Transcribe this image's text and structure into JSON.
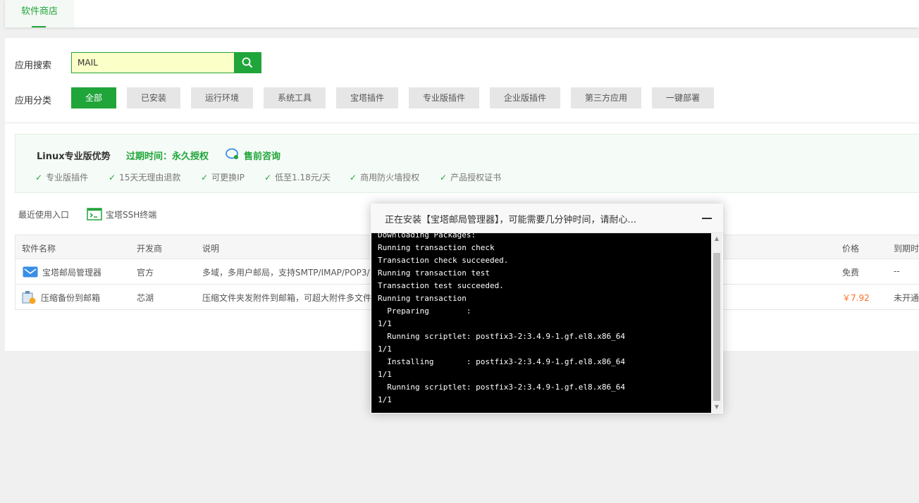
{
  "top_tab": {
    "label": "软件商店"
  },
  "search": {
    "label": "应用搜索",
    "value": "MAIL"
  },
  "categories": {
    "label": "应用分类",
    "items": [
      "全部",
      "已安装",
      "运行环境",
      "系统工具",
      "宝塔插件",
      "专业版插件",
      "企业版插件",
      "第三方应用",
      "一键部署"
    ],
    "active": "全部"
  },
  "promo": {
    "title": "Linux专业版优势",
    "expire": "过期时间：永久授权",
    "consult": "售前咨询",
    "features": [
      "专业版插件",
      "15天无理由退款",
      "可更换IP",
      "低至1.18元/天",
      "商用防火墙授权",
      "产品授权证书"
    ]
  },
  "recent": {
    "label": "最近使用入口",
    "ssh_label": "宝塔SSH终端"
  },
  "table": {
    "headers": {
      "name": "软件名称",
      "vendor": "开发商",
      "desc": "说明",
      "price": "价格",
      "expire": "到期时"
    },
    "rows": [
      {
        "name": "宝塔邮局管理器",
        "vendor": "官方",
        "desc": "多域，多用户邮局，支持SMTP/IMAP/POP3/",
        "price": "免费",
        "expire": "--"
      },
      {
        "name": "压缩备份到邮箱",
        "vendor": "芯湖",
        "desc": "压缩文件夹发附件到邮箱，可超大附件多文件",
        "price": "￥7.92",
        "expire": "未开通"
      }
    ]
  },
  "dialog": {
    "title": "正在安装【宝塔邮局管理器】，可能需要几分钟时间，请耐心...",
    "console": "Downloading Packages:\nRunning transaction check\nTransaction check succeeded.\nRunning transaction test\nTransaction test succeeded.\nRunning transaction\n  Preparing        :\n1/1\n  Running scriptlet: postfix3-2:3.4.9-1.gf.el8.x86_64\n1/1\n  Installing       : postfix3-2:3.4.9-1.gf.el8.x86_64\n1/1\n  Running scriptlet: postfix3-2:3.4.9-1.gf.el8.x86_64\n1/1"
  },
  "colors": {
    "accent": "#20a53a",
    "price": "#fc6d26",
    "search_bg": "#fbffc8"
  }
}
